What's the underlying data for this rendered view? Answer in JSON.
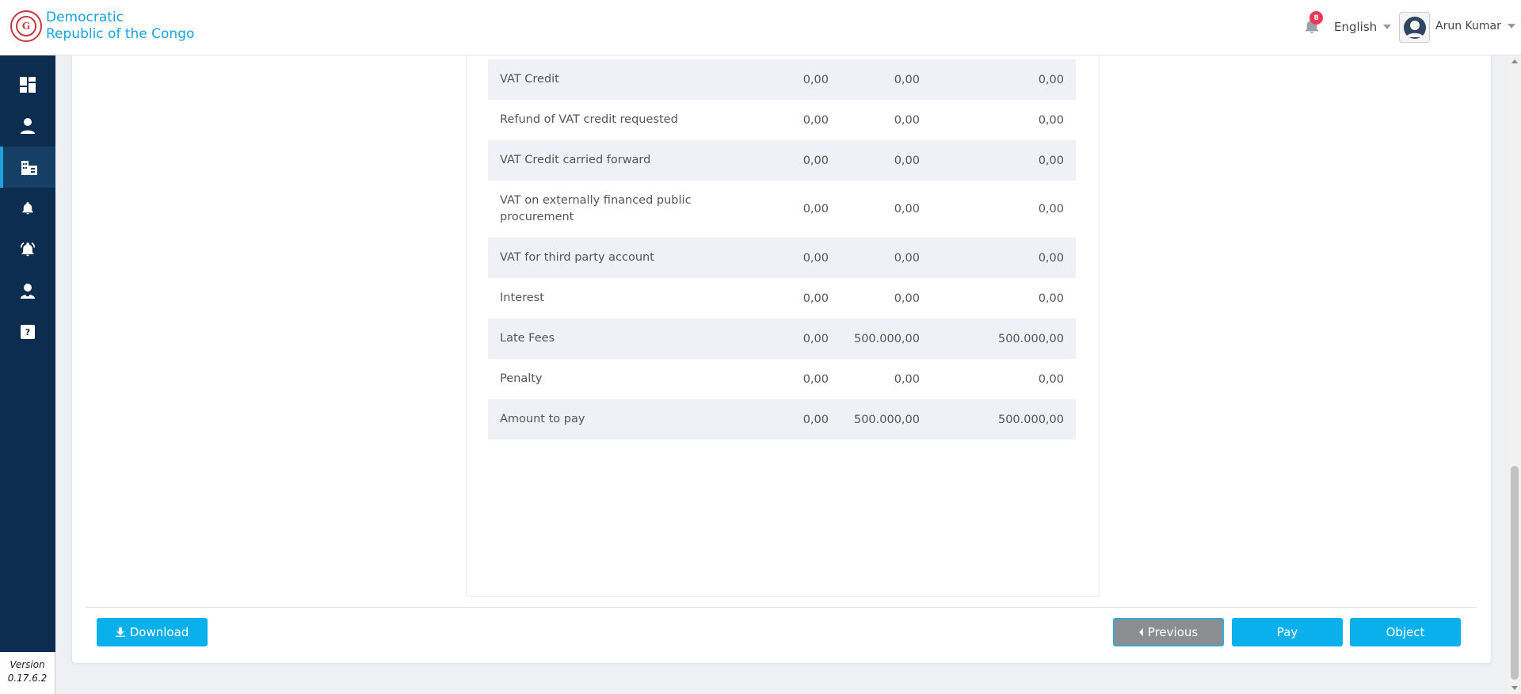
{
  "header": {
    "brand_line1": "Democratic",
    "brand_line2": "Republic of the Congo",
    "notification_count": "8",
    "language": "English",
    "user_name": "Arun Kumar"
  },
  "sidebar": {
    "items": [
      {
        "icon": "dashboard-icon"
      },
      {
        "icon": "user-icon"
      },
      {
        "icon": "building-icon",
        "active": true
      },
      {
        "icon": "bell-icon"
      },
      {
        "icon": "alert-bell-icon"
      },
      {
        "icon": "support-agent-icon"
      },
      {
        "icon": "help-icon"
      }
    ],
    "version_label": "Version",
    "version_number": "0.17.6.2"
  },
  "table": {
    "rows": [
      {
        "label": "VAT Credit",
        "v1": "0,00",
        "v2": "0,00",
        "v3": "0,00"
      },
      {
        "label": "Refund of VAT credit requested",
        "v1": "0,00",
        "v2": "0,00",
        "v3": "0,00"
      },
      {
        "label": "VAT Credit carried forward",
        "v1": "0,00",
        "v2": "0,00",
        "v3": "0,00"
      },
      {
        "label": "VAT on externally financed public procurement",
        "v1": "0,00",
        "v2": "0,00",
        "v3": "0,00"
      },
      {
        "label": "VAT for third party account",
        "v1": "0,00",
        "v2": "0,00",
        "v3": "0,00"
      },
      {
        "label": "Interest",
        "v1": "0,00",
        "v2": "0,00",
        "v3": "0,00"
      },
      {
        "label": "Late Fees",
        "v1": "0,00",
        "v2": "500.000,00",
        "v3": "500.000,00"
      },
      {
        "label": "Penalty",
        "v1": "0,00",
        "v2": "0,00",
        "v3": "0,00"
      },
      {
        "label": "Amount to pay",
        "v1": "0,00",
        "v2": "500.000,00",
        "v3": "500.000,00"
      }
    ]
  },
  "actions": {
    "download_label": "Download",
    "previous_label": "Previous",
    "pay_label": "Pay",
    "object_label": "Object"
  },
  "colors": {
    "accent": "#0ab0ec",
    "sidebar": "#0c2d4f",
    "badge": "#f0385a"
  }
}
